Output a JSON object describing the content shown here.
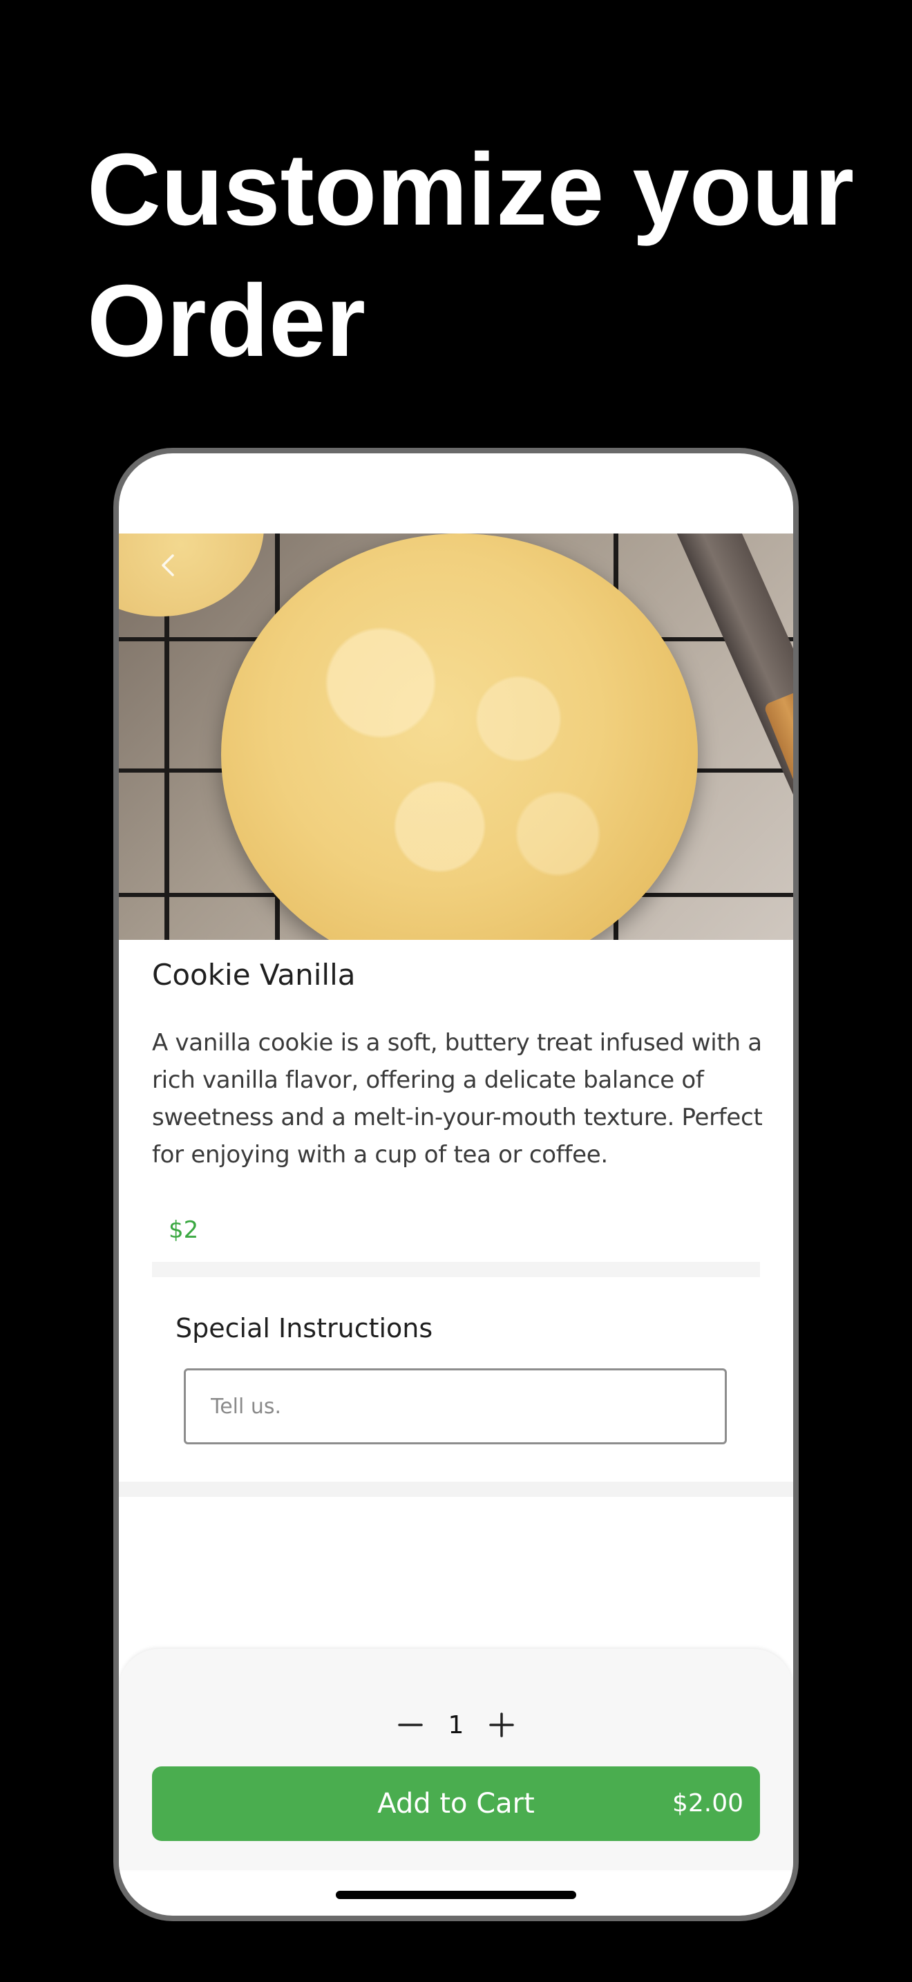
{
  "headline": {
    "line1": "Customize your",
    "line2": "Order"
  },
  "product": {
    "name": "Cookie Vanilla",
    "description": "A vanilla cookie is a soft, buttery treat infused with a rich vanilla flavor, offering a delicate balance of sweetness and a melt-in-your-mouth texture. Perfect for enjoying with a cup of tea or coffee.",
    "price": "$2"
  },
  "special_instructions": {
    "title": "Special Instructions",
    "placeholder": "Tell us."
  },
  "cart": {
    "quantity": "1",
    "add_label": "Add to Cart",
    "total": "$2.00"
  },
  "colors": {
    "accent_green": "#4aad4f",
    "price_green": "#3aa841",
    "background": "#000000"
  },
  "icons": [
    "back-chevron-icon",
    "minus-icon",
    "plus-icon"
  ]
}
